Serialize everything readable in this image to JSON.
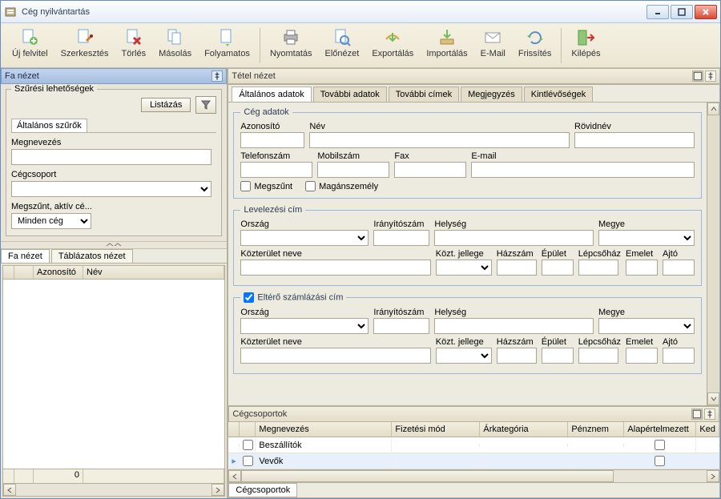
{
  "window": {
    "title": "Cég nyilvántartás"
  },
  "toolbar": {
    "uj_felvitel": "Új felvitel",
    "szerkesztes": "Szerkesztés",
    "torles": "Törlés",
    "masolas": "Másolás",
    "folyamatos": "Folyamatos",
    "nyomtatas": "Nyomtatás",
    "elonezet": "Előnézet",
    "exportalas": "Exportálás",
    "importalas": "Importálás",
    "email": "E-Mail",
    "frissites": "Frissítés",
    "kilepes": "Kilépés"
  },
  "left": {
    "pane_title": "Fa nézet",
    "filters_legend": "Szűrési lehetőségek",
    "listazas": "Listázás",
    "altalanos_szurok": "Általános szűrők",
    "megnevezes": "Megnevezés",
    "cegcsoport": "Cégcsoport",
    "megszunt_aktiv": "Megszűnt, aktív cé...",
    "minden_ceg": "Minden cég",
    "tab_fa_nezet": "Fa nézet",
    "tab_tablazatos": "Táblázatos nézet",
    "col_azonosito": "Azonosító",
    "col_nev": "Név",
    "footer_zero": "0"
  },
  "right": {
    "pane_title": "Tétel nézet",
    "tabs": {
      "altalanos_adatok": "Általános adatok",
      "tovabbi_adatok": "További adatok",
      "tovabbi_cimek": "További címek",
      "megjegyzes": "Megjegyzés",
      "kintlevosegek": "Kintlévőségek"
    },
    "group_ceg_adatok": "Cég adatok",
    "azonosito": "Azonosító",
    "nev": "Név",
    "rovidnev": "Rövidnév",
    "telefonszam": "Telefonszám",
    "mobilszam": "Mobilszám",
    "fax": "Fax",
    "email": "E-mail",
    "megszunt": "Megszűnt",
    "maganszemely": "Magánszemély",
    "group_levelezesi": "Levelezési cím",
    "group_eltero": "Eltérő számlázási cím",
    "orszag": "Ország",
    "iranyitoszam": "Irányítószám",
    "helyseg": "Helység",
    "megye": "Megye",
    "kozterulet_neve": "Közterület neve",
    "kozt_jellege": "Közt. jellege",
    "hazszam": "Házszám",
    "epulet": "Épület",
    "lepcsohaz": "Lépcsőház",
    "emelet": "Emelet",
    "ajto": "Ajtó",
    "sub_title": "Cégcsoportok",
    "sub_cols": {
      "megnevezes": "Megnevezés",
      "fizetesi_mod": "Fizetési mód",
      "arkategoria": "Árkategória",
      "penznem": "Pénznem",
      "alapertelmezett": "Alapértelmezett",
      "ked": "Ked"
    },
    "sub_rows": {
      "beszallitok": "Beszállítók",
      "vevok": "Vevők"
    },
    "bottom_tab": "Cégcsoportok"
  }
}
